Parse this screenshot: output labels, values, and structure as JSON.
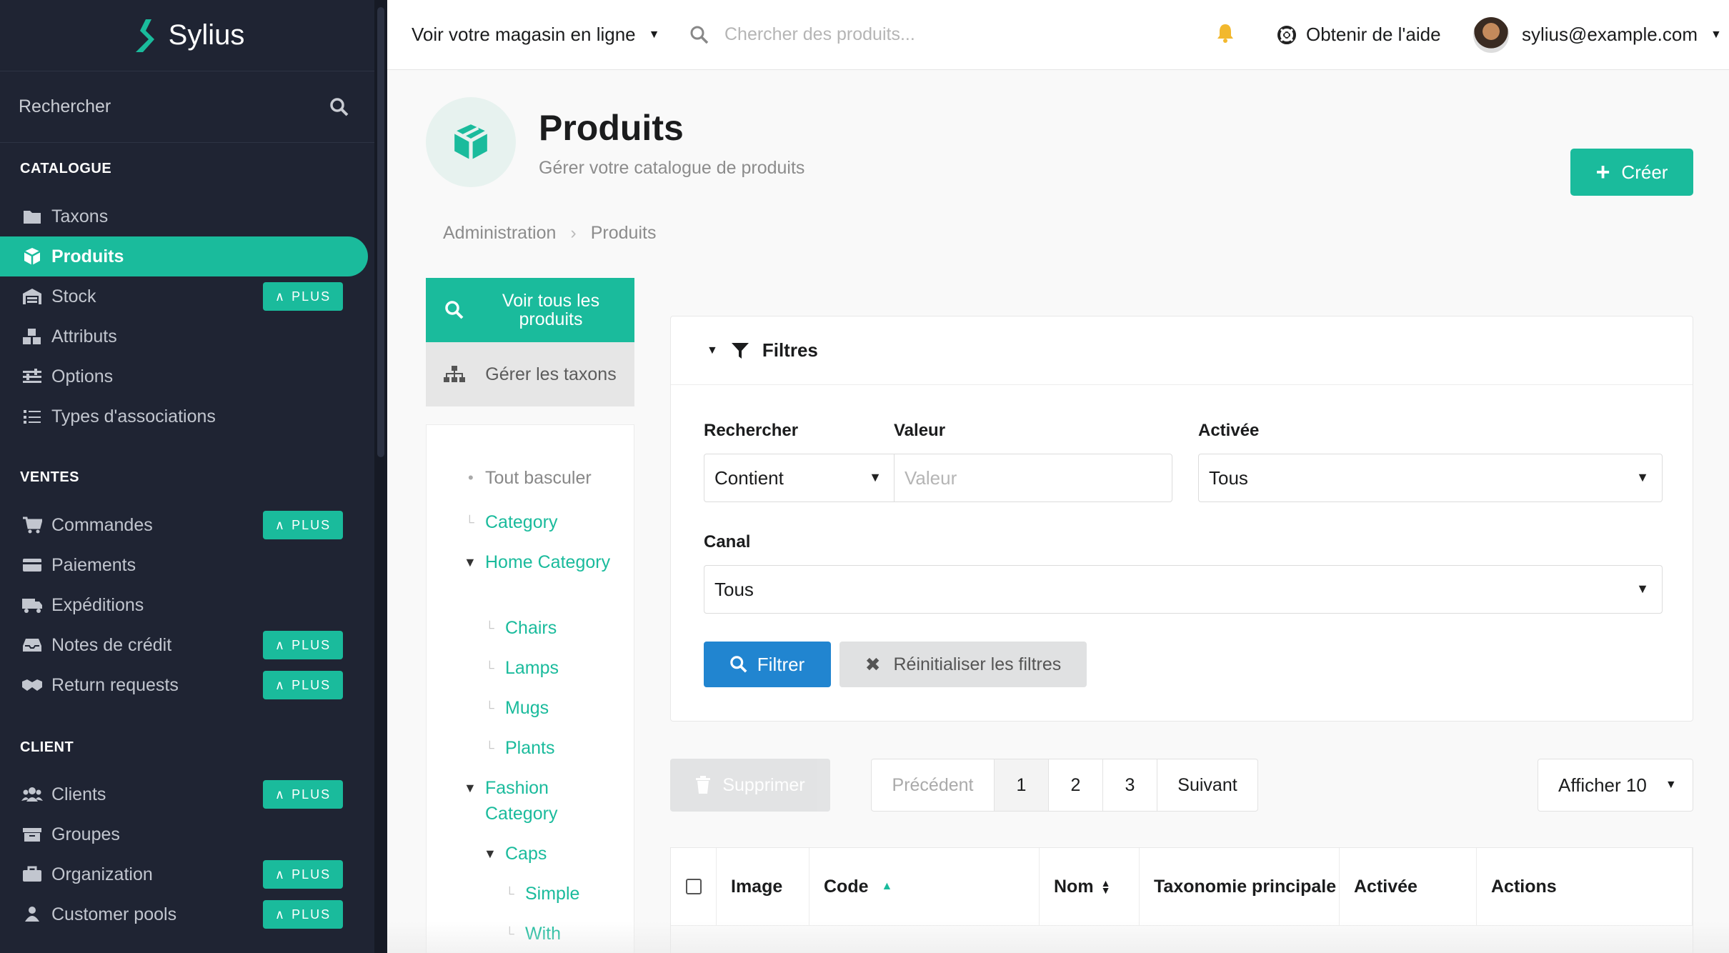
{
  "brand": {
    "name": "Sylius",
    "accent": "#1abb9c",
    "sidebar_bg": "#1f2433"
  },
  "sidebar": {
    "search_label": "Rechercher",
    "sections": [
      {
        "title": "CATALOGUE",
        "items": [
          {
            "label": "Taxons",
            "icon": "folder-icon",
            "plus": false,
            "active": false
          },
          {
            "label": "Produits",
            "icon": "cube-icon",
            "plus": false,
            "active": true
          },
          {
            "label": "Stock",
            "icon": "warehouse-icon",
            "plus": true,
            "active": false
          },
          {
            "label": "Attributs",
            "icon": "cubes-icon",
            "plus": false,
            "active": false
          },
          {
            "label": "Options",
            "icon": "sliders-icon",
            "plus": false,
            "active": false
          },
          {
            "label": "Types d'associations",
            "icon": "tasks-icon",
            "plus": false,
            "active": false
          }
        ]
      },
      {
        "title": "VENTES",
        "items": [
          {
            "label": "Commandes",
            "icon": "cart-icon",
            "plus": true
          },
          {
            "label": "Paiements",
            "icon": "payment-icon",
            "plus": false
          },
          {
            "label": "Expéditions",
            "icon": "truck-icon",
            "plus": false
          },
          {
            "label": "Notes de crédit",
            "icon": "inbox-icon",
            "plus": true
          },
          {
            "label": "Return requests",
            "icon": "handshake-icon",
            "plus": true
          }
        ]
      },
      {
        "title": "CLIENT",
        "items": [
          {
            "label": "Clients",
            "icon": "users-icon",
            "plus": true
          },
          {
            "label": "Groupes",
            "icon": "archive-icon",
            "plus": false
          },
          {
            "label": "Organization",
            "icon": "briefcase-icon",
            "plus": true
          },
          {
            "label": "Customer pools",
            "icon": "pool-icon",
            "plus": true
          }
        ]
      }
    ],
    "plus_label": "PLUS"
  },
  "topbar": {
    "store_label": "Voir votre magasin en ligne",
    "search_placeholder": "Chercher des produits...",
    "help_label": "Obtenir de l'aide",
    "user_email": "sylius@example.com"
  },
  "header": {
    "title": "Produits",
    "subtitle": "Gérer votre catalogue de produits",
    "create_label": "Créer",
    "breadcrumb": [
      "Administration",
      "Produits"
    ]
  },
  "leftnav": {
    "view_all": "Voir tous les produits",
    "manage_taxons": "Gérer les taxons",
    "toggle_all": "Tout basculer",
    "tree": [
      "Category",
      "Home Category",
      "Chairs",
      "Lamps",
      "Mugs",
      "Plants",
      "Fashion Category",
      "Caps",
      "Simple",
      "With"
    ]
  },
  "filters": {
    "title": "Filtres",
    "search_label": "Rechercher",
    "search_type": "Contient",
    "value_label": "Valeur",
    "value_placeholder": "Valeur",
    "enabled_label": "Activée",
    "enabled_value": "Tous",
    "channel_label": "Canal",
    "channel_value": "Tous",
    "filter_btn": "Filtrer",
    "reset_btn": "Réinitialiser les filtres"
  },
  "actions": {
    "delete": "Supprimer",
    "prev": "Précédent",
    "pages": [
      "1",
      "2",
      "3"
    ],
    "current_page": "1",
    "next": "Suivant",
    "show": "Afficher 10"
  },
  "table": {
    "columns": [
      "Image",
      "Code",
      "Nom",
      "Taxonomie principale",
      "Activée",
      "Actions"
    ]
  }
}
